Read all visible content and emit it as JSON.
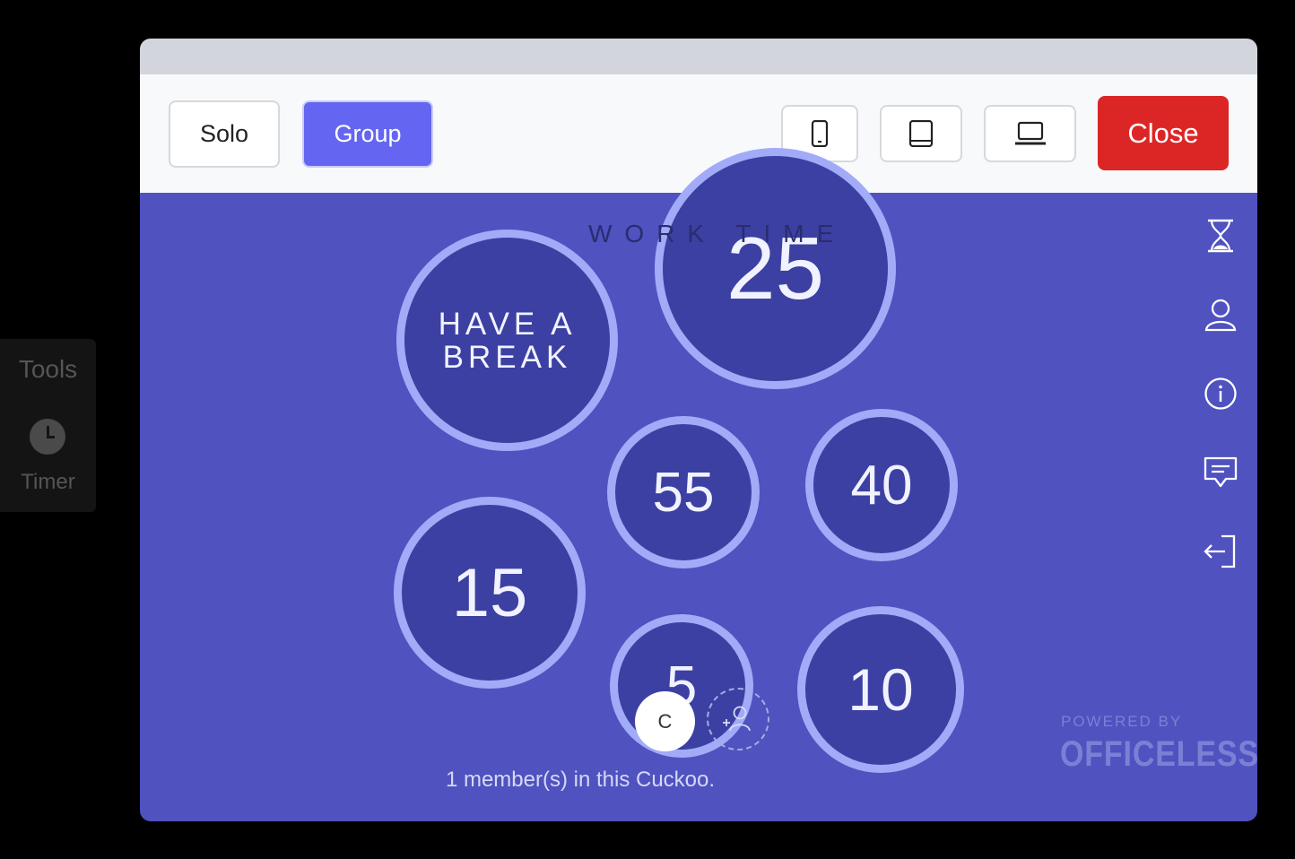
{
  "tools_panel": {
    "title": "Tools",
    "items": [
      {
        "label": "Timer",
        "icon": "clock-icon"
      }
    ]
  },
  "toolbar": {
    "solo_label": "Solo",
    "group_label": "Group",
    "active_mode": "Group",
    "device_buttons": [
      "phone-icon",
      "tablet-icon",
      "laptop-icon"
    ],
    "close_label": "Close"
  },
  "timer": {
    "status_label": "WORK TIME",
    "current_minutes": "25",
    "break_label": "HAVE A BREAK",
    "options": [
      "55",
      "40",
      "15",
      "5",
      "10"
    ]
  },
  "members": {
    "avatar_initial": "C",
    "count_text": "1 member(s) in this Cuckoo."
  },
  "sidebar_icons": [
    "hourglass-icon",
    "user-icon",
    "info-icon",
    "feedback-icon",
    "exit-icon"
  ],
  "branding": {
    "powered_by": "POWERED BY",
    "brand": "OFFICELESS"
  },
  "colors": {
    "background": "#4f52bf",
    "bubble": "#3c40a2",
    "bubble_ring": "#a1abf8",
    "group_active": "#6466f1",
    "close": "#dc2626"
  }
}
